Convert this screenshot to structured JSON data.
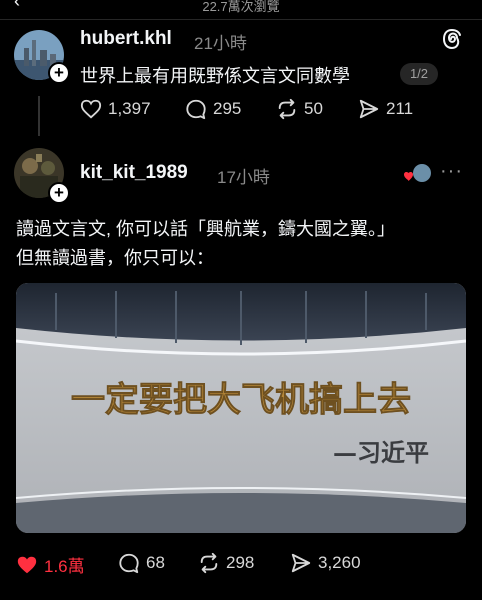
{
  "header": {
    "back": "‹",
    "views": "22.7萬次瀏覽"
  },
  "post1": {
    "username": "hubert.khl",
    "time": "21小時",
    "text": "世界上最有用既野係文言文同數學",
    "pager": "1/2",
    "likes": "1,397",
    "comments": "295",
    "reposts": "50",
    "shares": "211"
  },
  "post2": {
    "username": "kit_kit_1989",
    "time": "17小時",
    "more": "···",
    "line1": "讀過文言文, 你可以話「興航業，鑄大國之翼。」",
    "line2": "但無讀過書，你只可以：",
    "image": {
      "slogan": "一定要把大飞机搞上去",
      "signature": "—习近平"
    },
    "likes": "1.6萬",
    "comments": "68",
    "reposts": "298",
    "shares": "3,260"
  },
  "colors": {
    "like_active": "#ff3040",
    "slogan_gold": "#b8893a",
    "background": "#000000"
  },
  "icons": [
    "heart-icon",
    "comment-icon",
    "repost-icon",
    "share-icon",
    "threads-logo-icon",
    "follow-plus-icon",
    "more-icon"
  ]
}
